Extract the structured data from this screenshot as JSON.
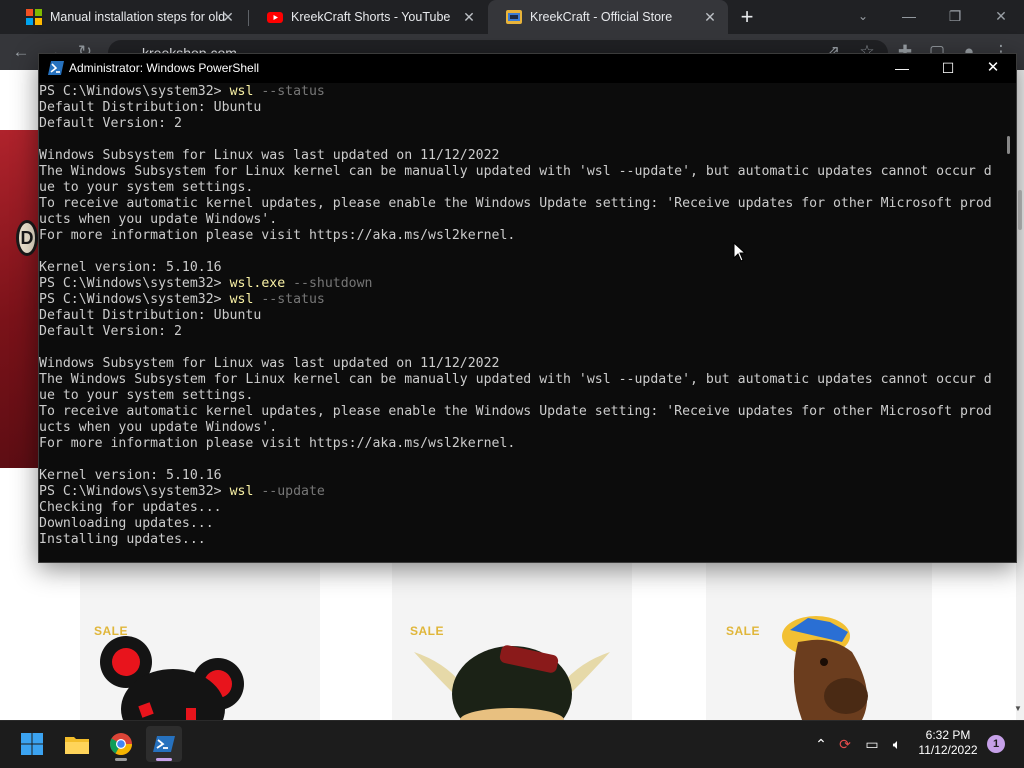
{
  "browser": {
    "tabs": [
      {
        "label": "Manual installation steps for olde",
        "favicon": "microsoft-icon"
      },
      {
        "label": "KreekCraft Shorts - YouTube",
        "favicon": "youtube-icon"
      },
      {
        "label": "KreekCraft - Official Store",
        "favicon": "kreekcraft-icon",
        "active": true
      }
    ],
    "address": "kreekshop.com"
  },
  "store": {
    "sale_labels": [
      "SALE",
      "SALE",
      "SALE"
    ],
    "logo_letter": "D"
  },
  "powershell": {
    "title": "Administrator: Windows PowerShell",
    "lines": [
      {
        "prompt": "PS C:\\Windows\\system32> ",
        "cmd": "wsl",
        "args": " --status"
      },
      {
        "text": "Default Distribution: Ubuntu"
      },
      {
        "text": "Default Version: 2"
      },
      {
        "text": ""
      },
      {
        "text": "Windows Subsystem for Linux was last updated on 11/12/2022"
      },
      {
        "text": "The Windows Subsystem for Linux kernel can be manually updated with 'wsl --update', but automatic updates cannot occur d"
      },
      {
        "text": "ue to your system settings."
      },
      {
        "text": "To receive automatic kernel updates, please enable the Windows Update setting: 'Receive updates for other Microsoft prod"
      },
      {
        "text": "ucts when you update Windows'."
      },
      {
        "text": "For more information please visit https://aka.ms/wsl2kernel."
      },
      {
        "text": ""
      },
      {
        "text": "Kernel version: 5.10.16"
      },
      {
        "prompt": "PS C:\\Windows\\system32> ",
        "cmd": "wsl.exe",
        "args": " --shutdown"
      },
      {
        "prompt": "PS C:\\Windows\\system32> ",
        "cmd": "wsl",
        "args": " --status"
      },
      {
        "text": "Default Distribution: Ubuntu"
      },
      {
        "text": "Default Version: 2"
      },
      {
        "text": ""
      },
      {
        "text": "Windows Subsystem for Linux was last updated on 11/12/2022"
      },
      {
        "text": "The Windows Subsystem for Linux kernel can be manually updated with 'wsl --update', but automatic updates cannot occur d"
      },
      {
        "text": "ue to your system settings."
      },
      {
        "text": "To receive automatic kernel updates, please enable the Windows Update setting: 'Receive updates for other Microsoft prod"
      },
      {
        "text": "ucts when you update Windows'."
      },
      {
        "text": "For more information please visit https://aka.ms/wsl2kernel."
      },
      {
        "text": ""
      },
      {
        "text": "Kernel version: 5.10.16"
      },
      {
        "prompt": "PS C:\\Windows\\system32> ",
        "cmd": "wsl",
        "args": " --update"
      },
      {
        "text": "Checking for updates..."
      },
      {
        "text": "Downloading updates..."
      },
      {
        "text": "Installing updates..."
      }
    ]
  },
  "taskbar": {
    "apps": [
      "windows-start-icon",
      "file-explorer-icon",
      "chrome-icon",
      "powershell-icon"
    ],
    "tray": [
      "chevron-up-icon",
      "sync-icon",
      "network-icon",
      "volume-icon"
    ],
    "time": "6:32 PM",
    "date": "11/12/2022",
    "notification_count": "1"
  },
  "colors": {
    "terminal_bg": "#0c0c0c",
    "terminal_text": "#cccccc",
    "command": "#f9f1a5",
    "argument": "#767676",
    "sale": "#e0b63a"
  }
}
